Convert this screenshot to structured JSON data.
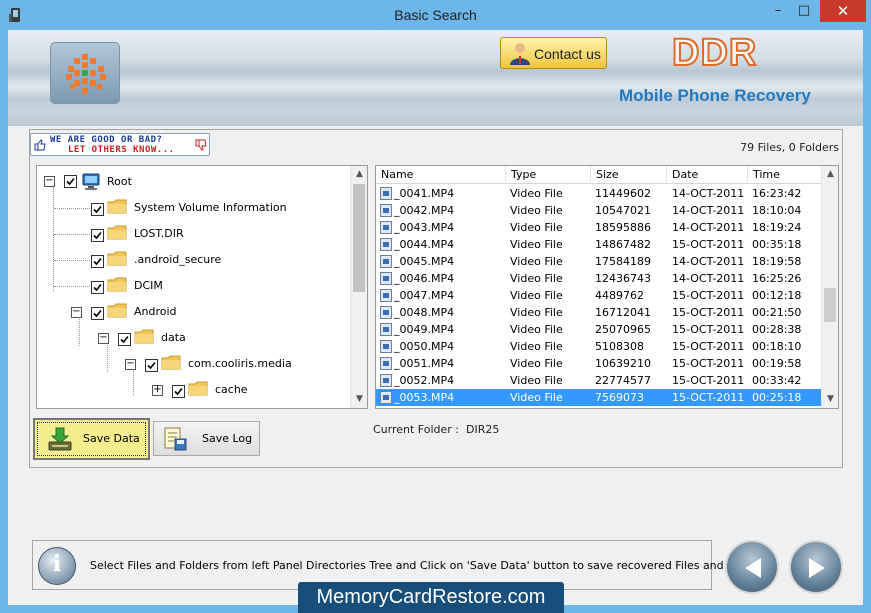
{
  "window": {
    "title": "Basic Search",
    "minimize_glyph": "–",
    "maximize_glyph": "□",
    "close_glyph": "✕"
  },
  "header": {
    "contact_label": "Contact us",
    "brand": "DDR",
    "product": "Mobile Phone Recovery"
  },
  "feedback": {
    "line1": "WE ARE GOOD OR BAD?",
    "line2": "LET OTHERS KNOW..."
  },
  "summary": {
    "count_text": "79 Files, 0 Folders"
  },
  "tree": {
    "nodes": [
      {
        "label": "Root"
      },
      {
        "label": "System Volume Information"
      },
      {
        "label": "LOST.DIR"
      },
      {
        "label": ".android_secure"
      },
      {
        "label": "DCIM"
      },
      {
        "label": "Android"
      },
      {
        "label": "data"
      },
      {
        "label": "com.cooliris.media"
      },
      {
        "label": "cache"
      }
    ]
  },
  "buttons": {
    "save_data": "Save Data",
    "save_log": "Save Log"
  },
  "file_list": {
    "columns": [
      "Name",
      "Type",
      "Size",
      "Date",
      "Time"
    ],
    "rows": [
      [
        "_0041.MP4",
        "Video File",
        "11449602",
        "14-OCT-2011",
        "16:23:42"
      ],
      [
        "_0042.MP4",
        "Video File",
        "10547021",
        "14-OCT-2011",
        "18:10:04"
      ],
      [
        "_0043.MP4",
        "Video File",
        "18595886",
        "14-OCT-2011",
        "18:19:24"
      ],
      [
        "_0044.MP4",
        "Video File",
        "14867482",
        "15-OCT-2011",
        "00:35:18"
      ],
      [
        "_0045.MP4",
        "Video File",
        "17584189",
        "14-OCT-2011",
        "18:19:58"
      ],
      [
        "_0046.MP4",
        "Video File",
        "12436743",
        "14-OCT-2011",
        "16:25:26"
      ],
      [
        "_0047.MP4",
        "Video File",
        "4489762",
        "15-OCT-2011",
        "00:12:18"
      ],
      [
        "_0048.MP4",
        "Video File",
        "16712041",
        "15-OCT-2011",
        "00:21:50"
      ],
      [
        "_0049.MP4",
        "Video File",
        "25070965",
        "15-OCT-2011",
        "00:28:38"
      ],
      [
        "_0050.MP4",
        "Video File",
        "5108308",
        "15-OCT-2011",
        "00:18:10"
      ],
      [
        "_0051.MP4",
        "Video File",
        "10639210",
        "15-OCT-2011",
        "00:19:58"
      ],
      [
        "_0052.MP4",
        "Video File",
        "22774577",
        "15-OCT-2011",
        "00:33:42"
      ],
      [
        "_0053.MP4",
        "Video File",
        "7569073",
        "15-OCT-2011",
        "00:25:18"
      ]
    ],
    "selected_index": 12
  },
  "current_folder": {
    "label": "Current Folder :",
    "value": "DIR25"
  },
  "status": {
    "message": "Select Files and Folders from left Panel Directories Tree and Click on 'Save Data' button to save recovered Files and Folders."
  },
  "footer": {
    "site": "MemoryCardRestore.com"
  },
  "icons": {
    "info": "info-icon",
    "back": "back-arrow-icon",
    "forward": "forward-arrow-icon"
  },
  "colors": {
    "selection": "#3399ff",
    "brand_orange": "#e06a2a",
    "product_blue": "#2479bd",
    "save_highlight": "#f5ee8e"
  }
}
